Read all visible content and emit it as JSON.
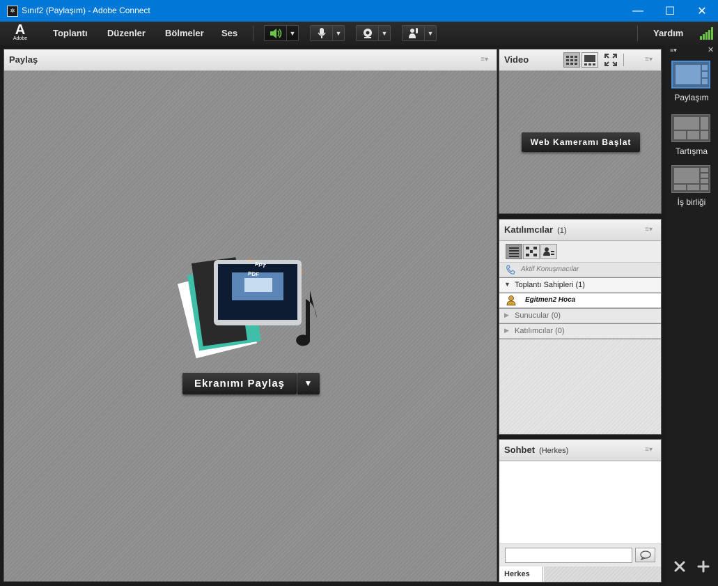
{
  "window": {
    "title": "Sınıf2 (Paylaşım) - Adobe Connect",
    "icon": "adobe-connect-app-icon",
    "controls": {
      "minimize": "—",
      "maximize": "☐",
      "close": "✕"
    }
  },
  "menubar": {
    "logo_letter": "A",
    "logo_word": "Adobe",
    "items": [
      "Toplantı",
      "Düzenler",
      "Bölmeler",
      "Ses"
    ],
    "help": "Yardım"
  },
  "share_pod": {
    "title": "Paylaş",
    "share_button": "Ekranımı Paylaş",
    "card_labels": [
      "PPT",
      "PDF"
    ]
  },
  "video_pod": {
    "title": "Video",
    "start_button": "Web Kameramı Başlat"
  },
  "attendees_pod": {
    "title": "Katılımcılar",
    "count": "(1)",
    "active_speakers": "Aktif Konuşmacılar",
    "groups": [
      {
        "label": "Toplantı Sahipleri (1)",
        "expanded": true
      },
      {
        "label": "Sunucular (0)",
        "expanded": false
      },
      {
        "label": "Katılımcılar (0)",
        "expanded": false
      }
    ],
    "host_name": "Egitmen2 Hoca"
  },
  "chat_pod": {
    "title": "Sohbet",
    "scope": "(Herkes)",
    "input_value": "",
    "tab": "Herkes"
  },
  "layouts": {
    "items": [
      "Paylaşım",
      "Tartışma",
      "İş birliği"
    ],
    "selected": "Paylaşım"
  },
  "colors": {
    "titlebar": "#0078d7",
    "signal": "#6cc644",
    "speaker_active": "#6cc644",
    "layout_selected": "#4a90d9"
  }
}
